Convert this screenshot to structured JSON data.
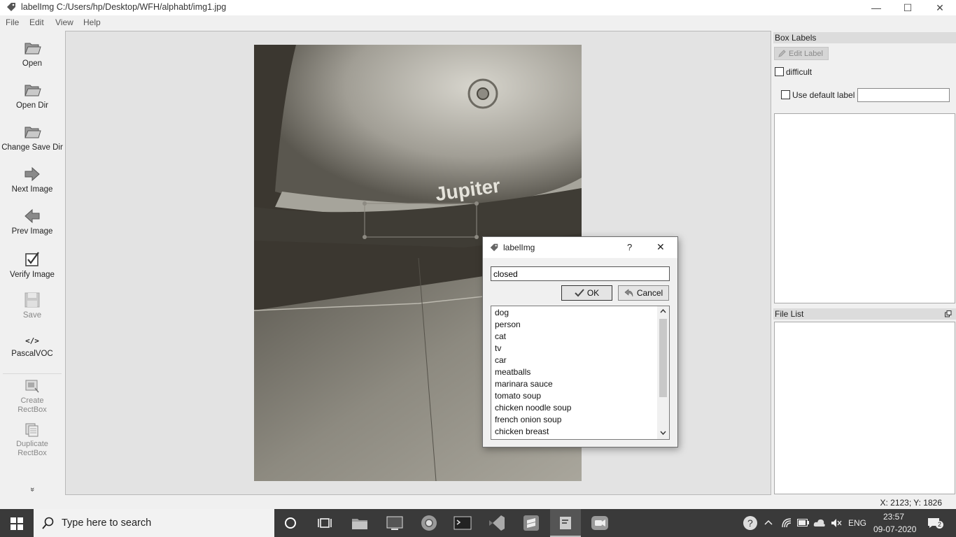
{
  "window": {
    "title": "labelImg C:/Users/hp/Desktop/WFH/alphabt/img1.jpg",
    "minimize_glyph": "—",
    "maximize_glyph": "☐",
    "close_glyph": "✕"
  },
  "menu": [
    "File",
    "Edit",
    "View",
    "Help"
  ],
  "toolbar": {
    "open": "Open",
    "open_dir": "Open Dir",
    "change_save_dir": "Change Save Dir",
    "next_image": "Next Image",
    "prev_image": "Prev Image",
    "verify_image": "Verify Image",
    "save": "Save",
    "format_glyph": "</>",
    "format": "PascalVOC",
    "create_rectbox_1": "Create",
    "create_rectbox_2": "RectBox",
    "duplicate_rectbox_1": "Duplicate",
    "duplicate_rectbox_2": "RectBox",
    "more_glyph": "»"
  },
  "right_dock": {
    "box_labels_title": "Box Labels",
    "edit_label": "Edit Label",
    "difficult": "difficult",
    "use_default_label": "Use default label",
    "default_label_value": "",
    "file_list_title": "File List"
  },
  "photo": {
    "brand_text": "Jupiter"
  },
  "dialog": {
    "title": "labelImg",
    "help_glyph": "?",
    "close_glyph": "✕",
    "input_value": "closed",
    "ok": "OK",
    "cancel": "Cancel",
    "labels": [
      "dog",
      "person",
      "cat",
      "tv",
      "car",
      "meatballs",
      "marinara sauce",
      "tomato soup",
      "chicken noodle soup",
      "french onion soup",
      "chicken breast"
    ]
  },
  "status": {
    "coords": "X: 2123; Y: 1826"
  },
  "taskbar": {
    "search_placeholder": "Type here to search",
    "language": "ENG",
    "time": "23:57",
    "date": "09-07-2020",
    "notification_count": "2"
  },
  "colors": {
    "taskbar": "#3a3a3a",
    "canvas": "#e3e3e3",
    "dialog": "#f0f0f0"
  }
}
